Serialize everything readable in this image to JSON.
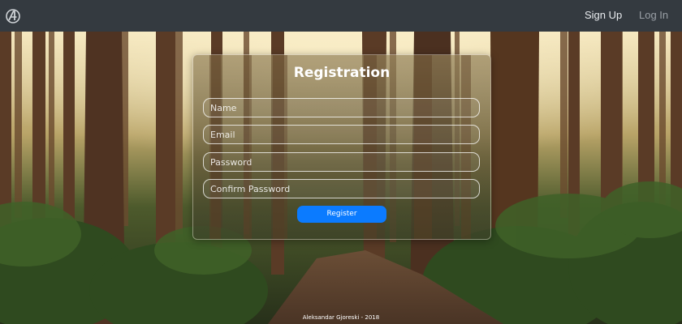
{
  "navbar": {
    "brand_icon": "avengers-logo-icon",
    "links": [
      {
        "label": "Sign Up"
      },
      {
        "label": "Log In"
      }
    ]
  },
  "form": {
    "title": "Registration",
    "fields": [
      {
        "placeholder": "Name",
        "value": ""
      },
      {
        "placeholder": "Email",
        "value": ""
      },
      {
        "placeholder": "Password",
        "value": ""
      },
      {
        "placeholder": "Confirm Password",
        "value": ""
      }
    ],
    "submit_label": "Register"
  },
  "footer": {
    "text": "Aleksandar Gjoreski - 2018"
  },
  "colors": {
    "navbar_bg": "#343a40",
    "button_bg": "#0b7bff",
    "nav_active": "#e9ecef",
    "nav_muted": "#9aa0a6"
  }
}
